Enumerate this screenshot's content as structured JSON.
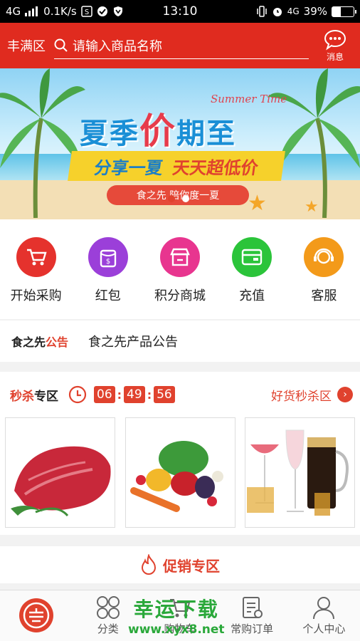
{
  "status_bar": {
    "network": "4G",
    "speed": "0.1K/s",
    "time": "13:10",
    "network2": "4G",
    "battery": "39%"
  },
  "header": {
    "region": "丰满区",
    "search_placeholder": "请输入商品名称",
    "message_label": "消息"
  },
  "banner": {
    "headline_part1": "夏季",
    "headline_big": "价",
    "headline_part2": "期至",
    "summer_time": "Summer Time",
    "ribbon_blue": "分享一夏",
    "ribbon_red": "天天超低价",
    "slogan": "食之先 陪你度一夏"
  },
  "quick_menu": [
    {
      "label": "开始采购",
      "icon": "cart-icon",
      "color": "#e5322d"
    },
    {
      "label": "红包",
      "icon": "red-packet-icon",
      "color": "#9b3fd9"
    },
    {
      "label": "积分商城",
      "icon": "store-icon",
      "color": "#e8358f"
    },
    {
      "label": "充值",
      "icon": "wallet-icon",
      "color": "#2bc43a"
    },
    {
      "label": "客服",
      "icon": "customer-service-icon",
      "color": "#f39a1a"
    }
  ],
  "notice": {
    "brand": "食之先",
    "brand_tag": "公告",
    "text": "食之先产品公告"
  },
  "flash_sale": {
    "title_red": "秒杀",
    "title_rest": "专区",
    "hours": "06",
    "minutes": "49",
    "seconds": "56",
    "more_label": "好货秒杀区",
    "products": [
      "beef",
      "vegetables",
      "drinks"
    ]
  },
  "promo": {
    "title": "促销专区"
  },
  "tab_bar": {
    "tabs": [
      {
        "label": "",
        "icon": "home-logo-icon"
      },
      {
        "label": "分类",
        "icon": "category-icon"
      },
      {
        "label": "购物车",
        "icon": "cart-icon"
      },
      {
        "label": "常购订单",
        "icon": "order-icon"
      },
      {
        "label": "个人中心",
        "icon": "user-icon"
      }
    ]
  },
  "watermark": {
    "line1": "幸运下载",
    "line2": "www.xyx8.net"
  }
}
